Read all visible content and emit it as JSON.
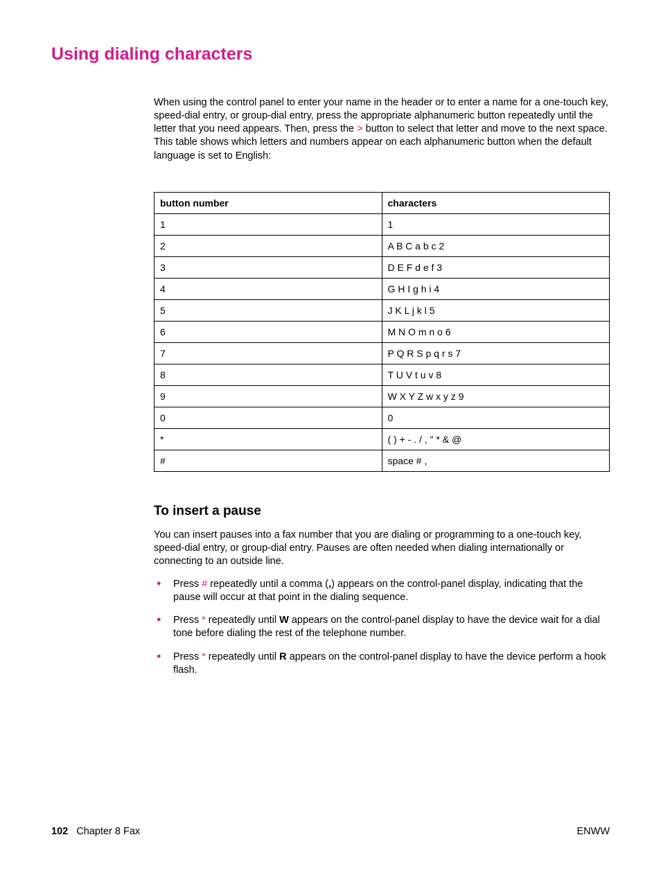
{
  "heading": "Using dialing characters",
  "intro": {
    "pre": "When using the control panel to enter your name in the header or to enter a name for a one-touch key, speed-dial entry, or group-dial entry, press the appropriate alphanumeric button repeatedly until the letter that you need appears. Then, press the ",
    "btn": ">",
    "post": " button to select that letter and move to the next space. This table shows which letters and numbers appear on each alphanumeric button when the default language is set to English:"
  },
  "table": {
    "h1": "button number",
    "h2": "characters",
    "rows": [
      {
        "b": "1",
        "c": "1"
      },
      {
        "b": "2",
        "c": "A B C a b c 2"
      },
      {
        "b": "3",
        "c": "D E F d e f 3"
      },
      {
        "b": "4",
        "c": "G H I g h i 4"
      },
      {
        "b": "5",
        "c": "J K L j k l 5"
      },
      {
        "b": "6",
        "c": "M N O m n o 6"
      },
      {
        "b": "7",
        "c": "P Q R S p q r s 7"
      },
      {
        "b": "8",
        "c": "T U V t u v 8"
      },
      {
        "b": "9",
        "c": "W X Y Z w x y z 9"
      },
      {
        "b": "0",
        "c": "0"
      },
      {
        "b": "*",
        "c": "( ) + - . / , \" * & @"
      },
      {
        "b": "#",
        "c": "space # ,"
      }
    ]
  },
  "sub": {
    "title": "To insert a pause",
    "para": "You can insert pauses into a fax number that you are dialing or programming to a one-touch key, speed-dial entry, or group-dial entry. Pauses are often needed when dialing internationally or connecting to an outside line.",
    "bullets": [
      {
        "pre": "Press ",
        "sym": "#",
        "mid1": " repeatedly until a comma (",
        "bold": ",",
        "mid2": ") appears on the control-panel display, indicating that the pause will occur at that point in the dialing sequence."
      },
      {
        "pre": "Press ",
        "sym": "*",
        "mid1": " repeatedly until ",
        "bold": "W",
        "mid2": " appears on the control-panel display to have the device wait for a dial tone before dialing the rest of the telephone number."
      },
      {
        "pre": "Press ",
        "sym": "*",
        "mid1": " repeatedly until ",
        "bold": "R",
        "mid2": " appears on the control-panel display to have the device perform a hook flash."
      }
    ]
  },
  "footer": {
    "pnum": "102",
    "chapter": "Chapter 8 Fax",
    "right": "ENWW"
  }
}
